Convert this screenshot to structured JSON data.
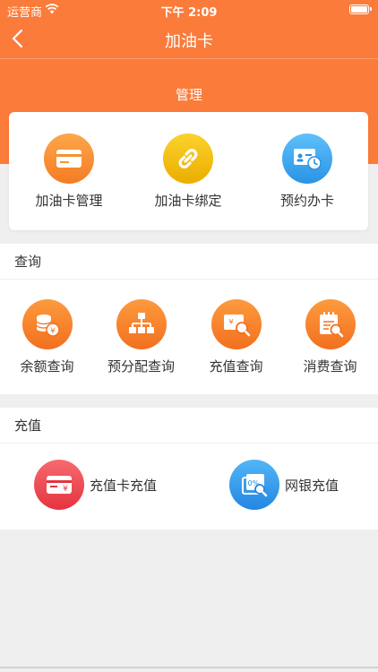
{
  "status_bar": {
    "carrier": "运营商",
    "time": "下午 2:09"
  },
  "nav": {
    "title": "加油卡"
  },
  "management": {
    "heading": "管理",
    "items": [
      {
        "label": "加油卡管理",
        "icon": "card-icon",
        "color": "#f98a2d"
      },
      {
        "label": "加油卡绑定",
        "icon": "link-icon",
        "color": "#f0b500"
      },
      {
        "label": "预约办卡",
        "icon": "appointment-card-icon",
        "color": "#3aa4ef"
      }
    ]
  },
  "query": {
    "title": "查询",
    "items": [
      {
        "label": "余额查询",
        "icon": "coin-stack-icon"
      },
      {
        "label": "预分配查询",
        "icon": "org-chart-icon"
      },
      {
        "label": "充值查询",
        "icon": "recharge-search-icon"
      },
      {
        "label": "消费查询",
        "icon": "calendar-search-icon"
      }
    ]
  },
  "recharge": {
    "title": "充值",
    "items": [
      {
        "label": "充值卡充值",
        "icon": "recharge-card-icon",
        "color": "#e9434e"
      },
      {
        "label": "网银充值",
        "icon": "bank-recharge-icon",
        "color": "#2d9be8"
      }
    ]
  },
  "colors": {
    "brand_orange": "#fb7b3a",
    "query_orange": "#f7822d"
  }
}
